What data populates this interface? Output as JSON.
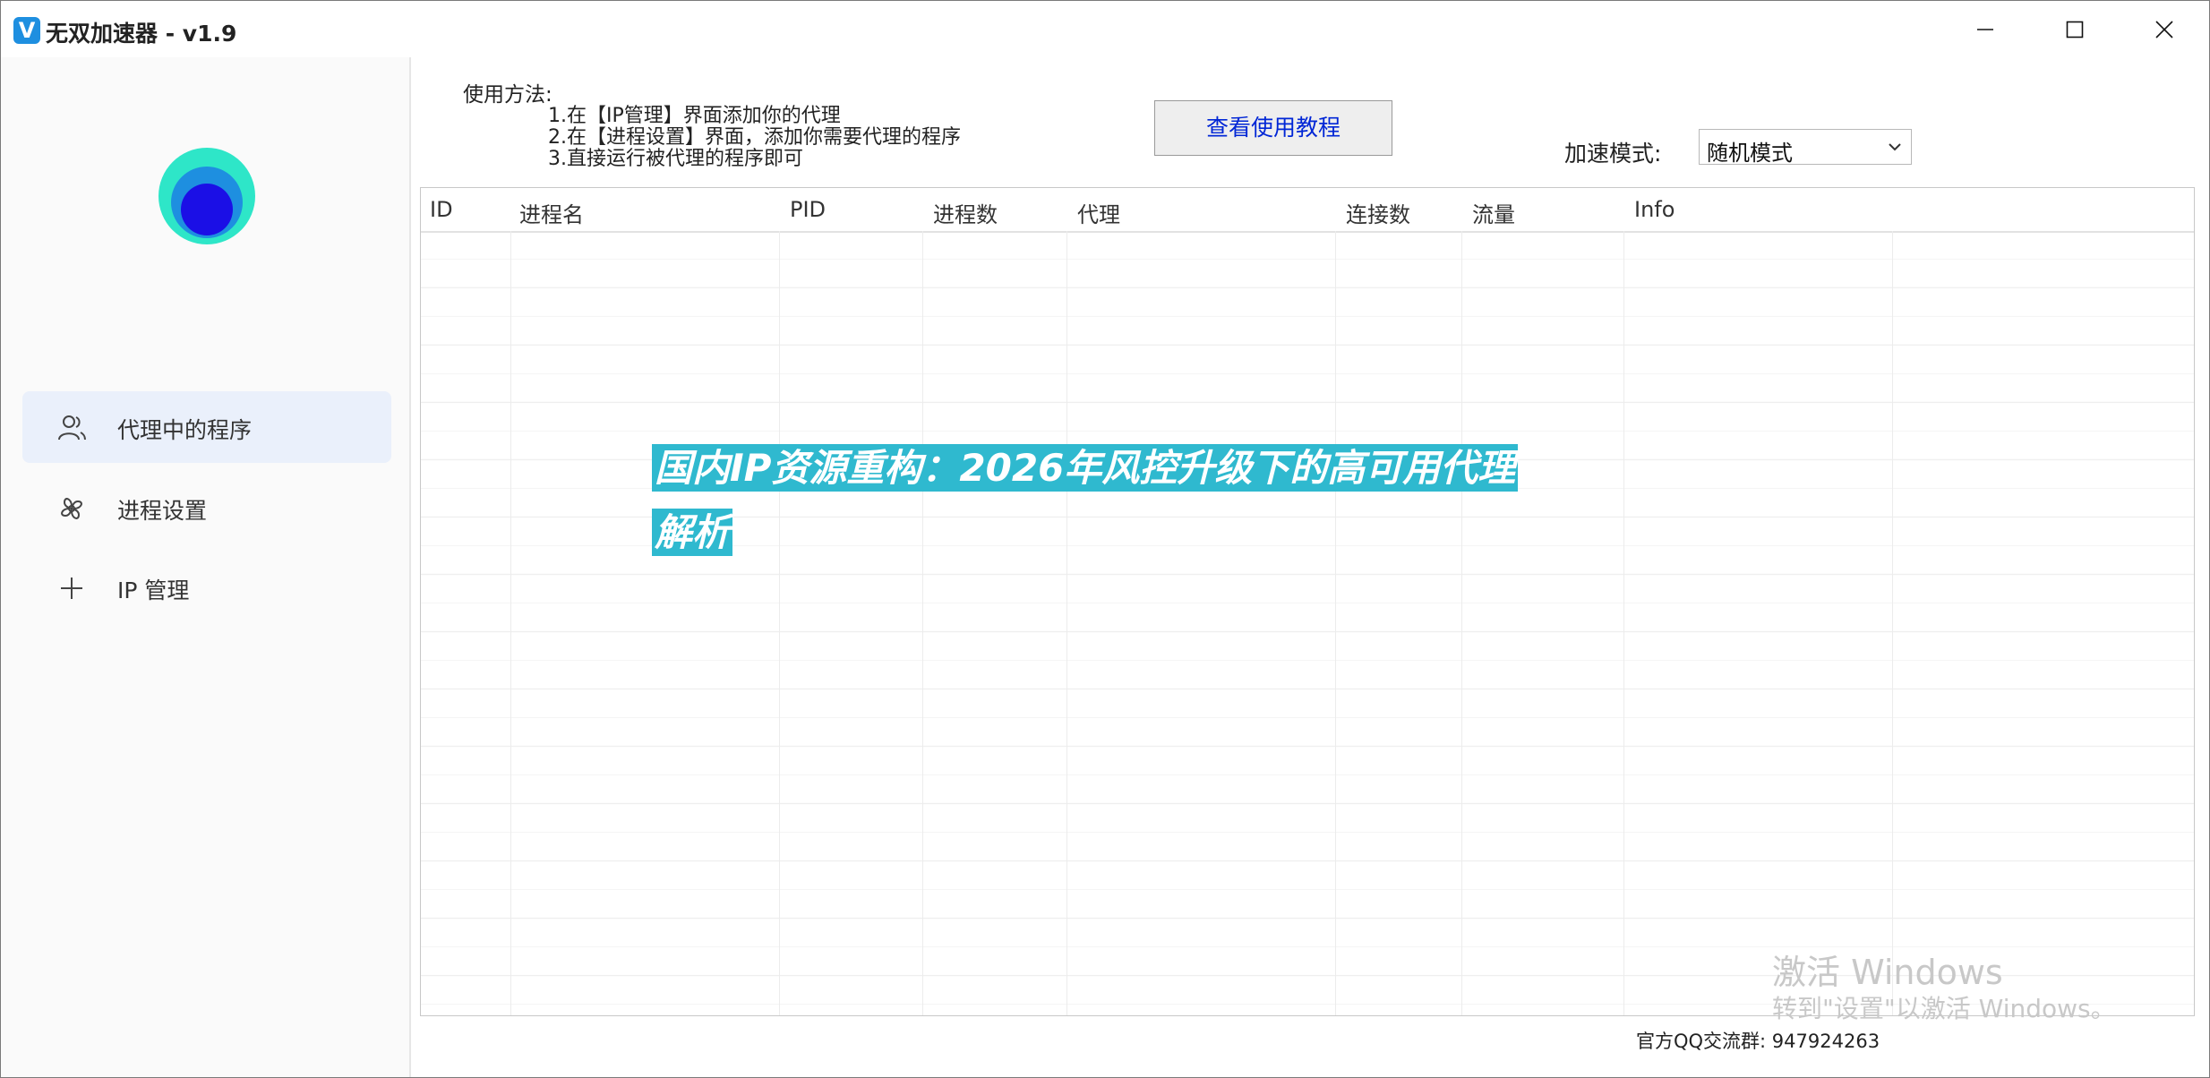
{
  "window": {
    "title": "无双加速器 - v1.9",
    "app_icon": "V",
    "controls": [
      "minimize-icon",
      "maximize-icon",
      "close-icon"
    ]
  },
  "sidebar": {
    "items": [
      {
        "label": "代理中的程序",
        "icon": "users-icon",
        "active": true
      },
      {
        "label": "进程设置",
        "icon": "pinwheel-icon",
        "active": false
      },
      {
        "label": "IP 管理",
        "icon": "plus-icon",
        "active": false
      }
    ]
  },
  "main": {
    "usage_title": "使用方法:",
    "usage_steps": [
      "1.在【IP管理】界面添加你的代理",
      "2.在【进程设置】界面，添加你需要代理的程序",
      "3.直接运行被代理的程序即可"
    ],
    "tutorial_button": "查看使用教程",
    "mode_label": "加速模式:",
    "mode_value": "随机模式",
    "table_headers": [
      "ID",
      "进程名",
      "PID",
      "进程数",
      "代理",
      "连接数",
      "流量",
      "Info"
    ],
    "footer": "官方QQ交流群: 947924263"
  },
  "overlay": {
    "banner": "国内IP资源重构：2026年风控升级下的高可用代理解析",
    "watermark_line1": "激活 Windows",
    "watermark_line2": "转到\"设置\"以激活 Windows。"
  },
  "colors": {
    "accent": "#2fb9cf",
    "link_blue": "#0026d6",
    "sidebar_active": "#eaf0fb",
    "logo_outer": "#2ee6c8",
    "logo_mid": "#1e8fe0",
    "logo_inner": "#1b0fe6"
  }
}
